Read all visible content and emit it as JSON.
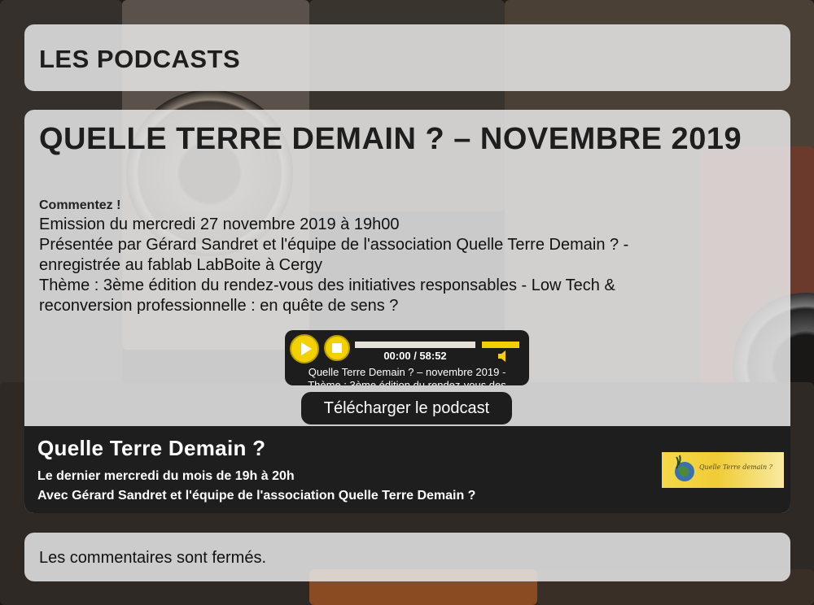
{
  "header": {
    "title": "LES PODCASTS"
  },
  "post": {
    "title": "QUELLE TERRE DEMAIN ? – NOVEMBRE 2019",
    "comment_link": "Commentez !",
    "lines": [
      "Emission du mercredi 27 novembre 2019 à 19h00",
      "Présentée par Gérard Sandret et l'équipe de l'association Quelle Terre Demain ? -",
      "enregistrée au fablab LabBoite à Cergy",
      "Thème : 3ème édition du rendez-vous des initiatives responsables - Low Tech &",
      "reconversion professionnelle : en quête de sens ?"
    ]
  },
  "player": {
    "time": "00:00 / 58:52",
    "progress": 0,
    "volume": 1,
    "track_line1": "Quelle Terre Demain ? – novembre 2019 -",
    "track_line2": "Thème : 3ème édition du rendez-vous des",
    "accent": "#f3d000",
    "icons": [
      "play-icon",
      "stop-icon",
      "speaker-icon"
    ]
  },
  "download": {
    "label": "Télécharger le podcast"
  },
  "show": {
    "title": "Quelle Terre Demain ?",
    "schedule": "Le dernier mercredi du mois de 19h à 20h",
    "hosts": "Avec Gérard Sandret et l'équipe de l'association Quelle Terre Demain ?",
    "logo_text": "Quelle Terre demain ?"
  },
  "comments": {
    "text": "Les commentaires sont fermés."
  }
}
